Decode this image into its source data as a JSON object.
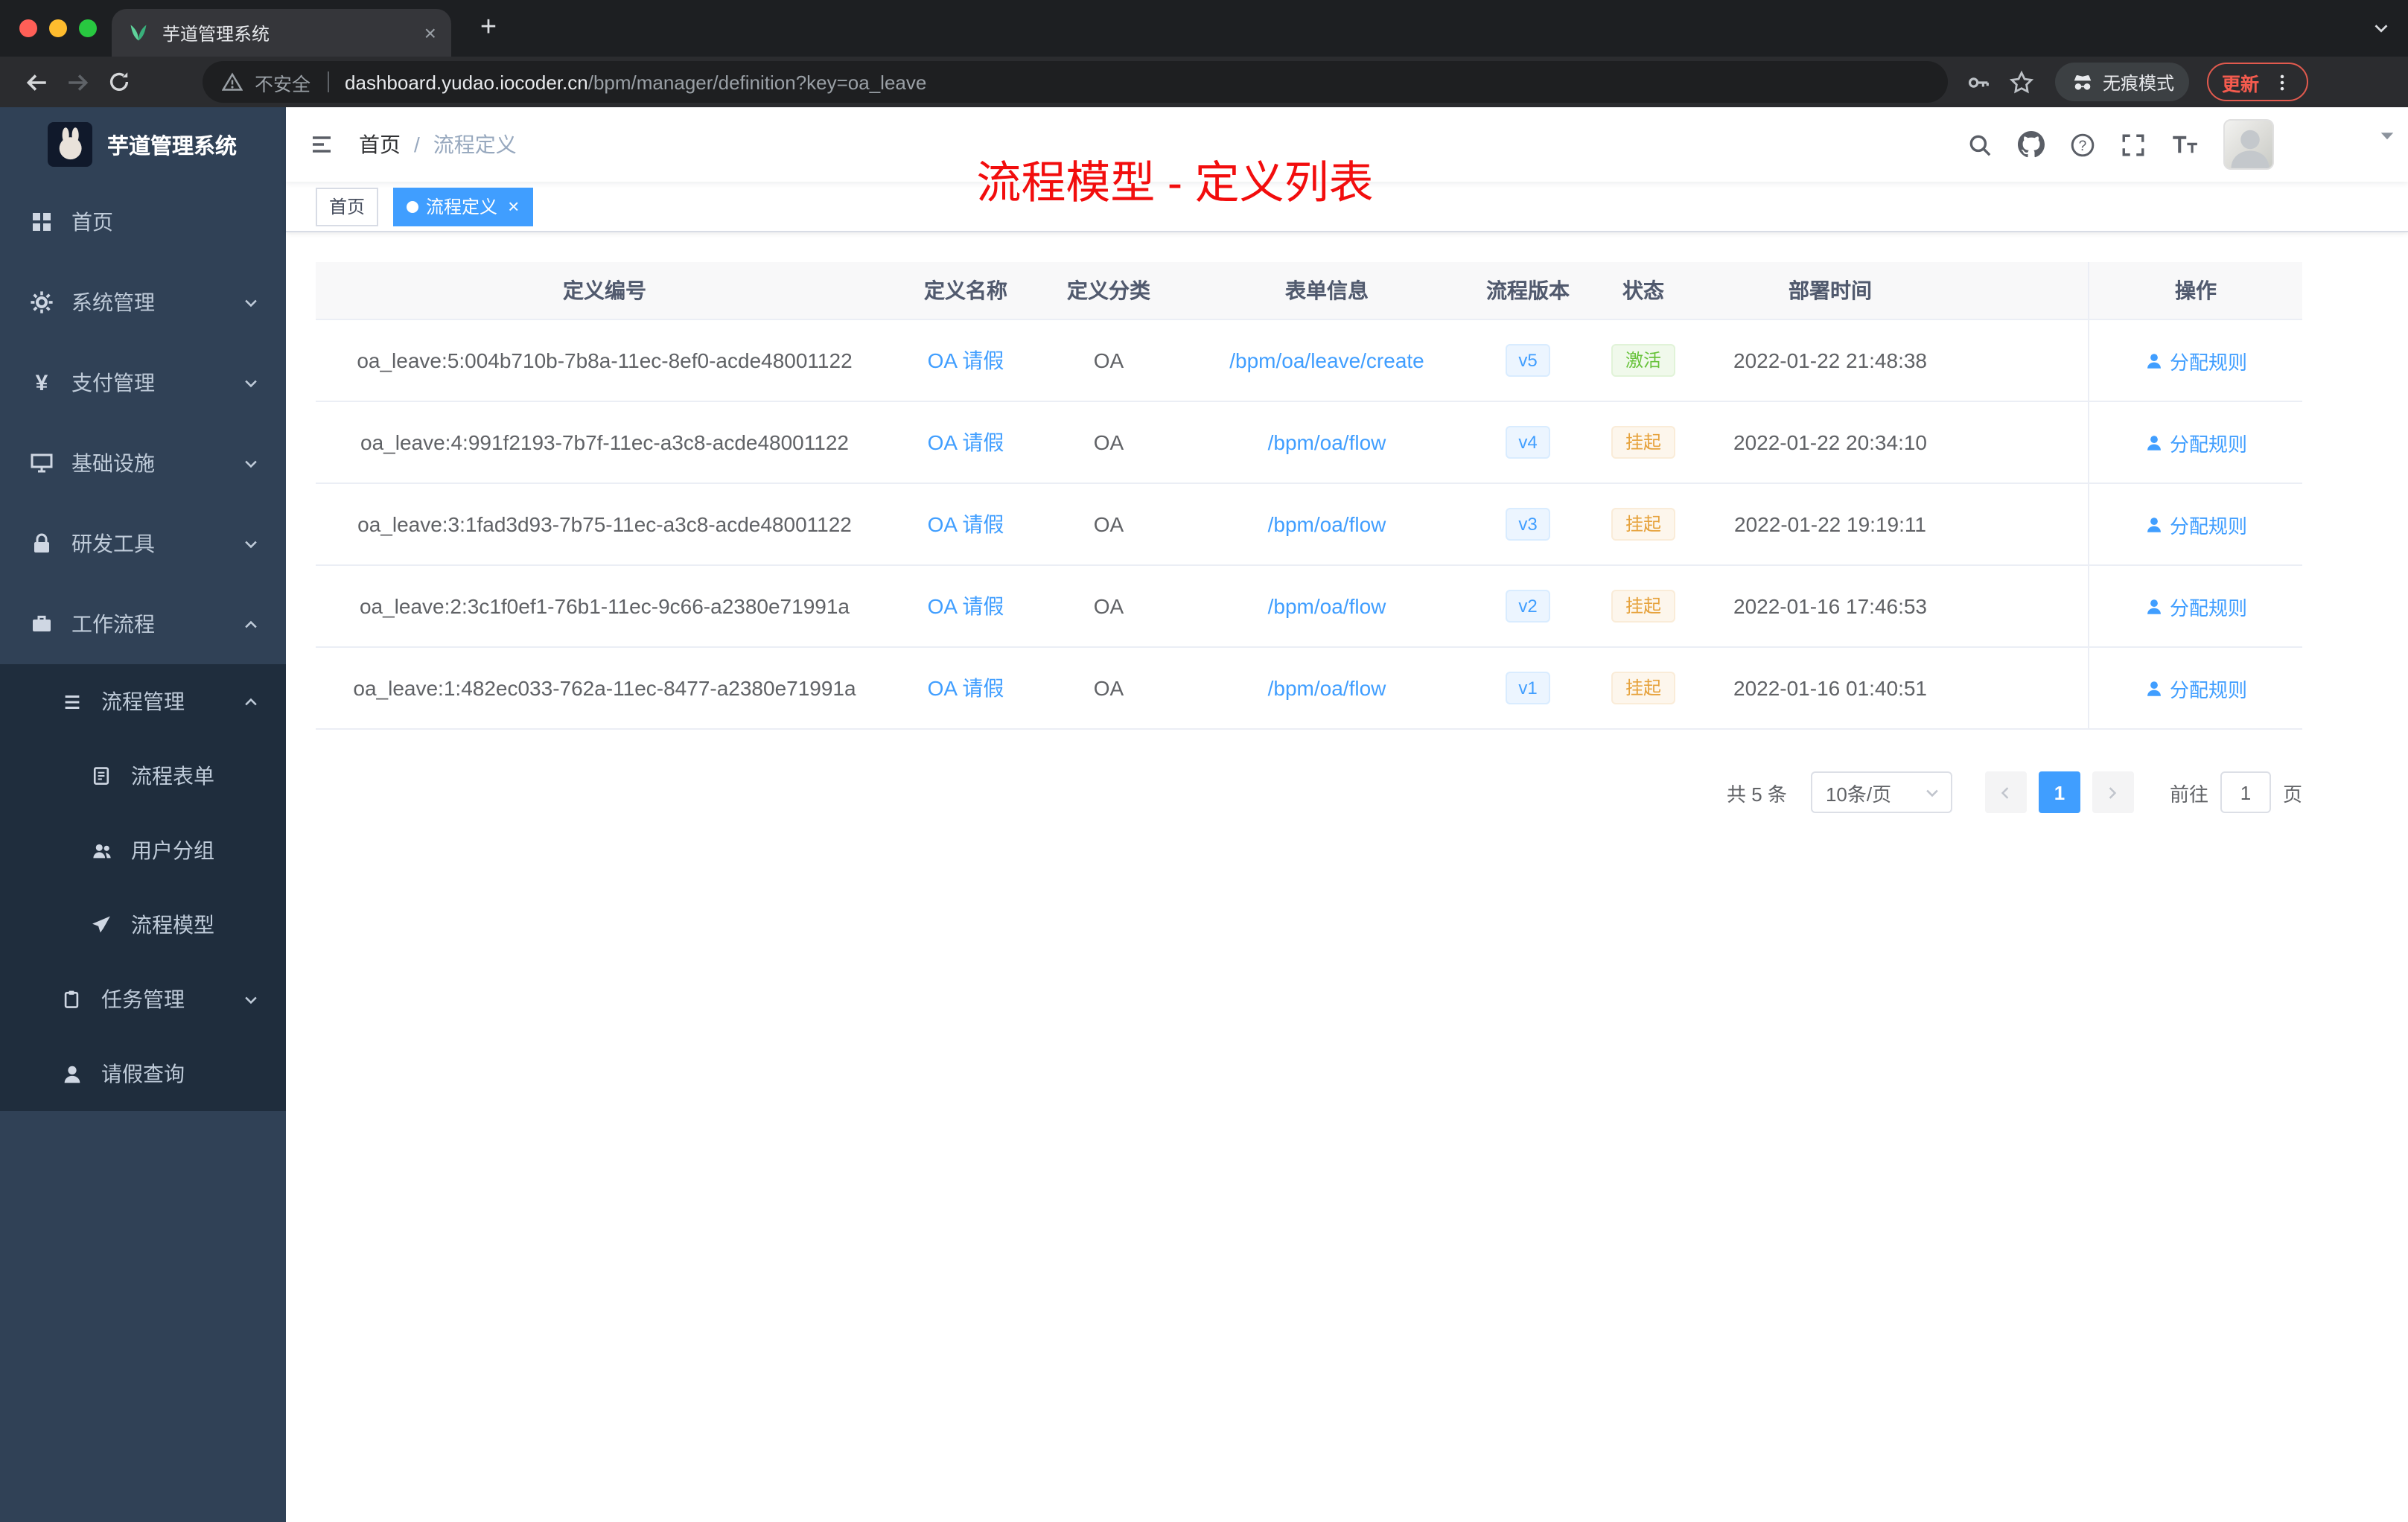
{
  "colors": {
    "accent_blue": "#409eff",
    "status_active_green": "#67c23a",
    "status_suspended_orange": "#e6a23c",
    "annotation_red": "#f20d0d",
    "sidebar_bg": "#304156",
    "sidebar_submenu_bg": "#1f2d3d",
    "update_chip_red": "#f55b4e"
  },
  "icons": {
    "favicon": "leaf shape",
    "tab_close": "×",
    "new_tab": "+",
    "back": "←",
    "forward": "→",
    "reload": "↻",
    "warning": "△",
    "key": "⚷",
    "star": "☆",
    "incognito": "spy hat",
    "menu_dots": "⋮",
    "chevron_down": "⌄",
    "chevron_up": "⌃",
    "search": "magnifier",
    "github": "octocat",
    "help": "?",
    "fullscreen": "⛶",
    "font_size": "Tt",
    "user": "person silhouette"
  },
  "browser": {
    "tab_title": "芋道管理系统",
    "tab_close": "×",
    "new_tab": "+",
    "security_label": "不安全",
    "url_host": "dashboard.yudao.iocoder.cn",
    "url_path": "/bpm/manager/definition?key=oa_leave",
    "incognito_label": "无痕模式",
    "update_label": "更新"
  },
  "sidebar": {
    "logo_title": "芋道管理系统",
    "items": [
      {
        "label": "首页"
      },
      {
        "label": "系统管理",
        "expandable": true
      },
      {
        "label": "支付管理",
        "expandable": true
      },
      {
        "label": "基础设施",
        "expandable": true
      },
      {
        "label": "研发工具",
        "expandable": true
      },
      {
        "label": "工作流程",
        "expandable": true,
        "expanded": true,
        "children": [
          {
            "label": "流程管理",
            "expanded": true,
            "children": [
              {
                "label": "流程表单"
              },
              {
                "label": "用户分组"
              },
              {
                "label": "流程模型"
              }
            ]
          },
          {
            "label": "任务管理",
            "expandable": true
          },
          {
            "label": "请假查询"
          }
        ]
      }
    ]
  },
  "header": {
    "breadcrumb": {
      "home": "首页",
      "sep": "/",
      "current": "流程定义"
    },
    "annotation": "流程模型 - 定义列表"
  },
  "tags_view": {
    "tags": [
      {
        "label": "首页",
        "active": false
      },
      {
        "label": "流程定义",
        "active": true,
        "close": "×"
      }
    ]
  },
  "table": {
    "columns": [
      "定义编号",
      "定义名称",
      "定义分类",
      "表单信息",
      "流程版本",
      "状态",
      "部署时间",
      "操作"
    ],
    "rows": [
      {
        "id": "oa_leave:5:004b710b-7b8a-11ec-8ef0-acde48001122",
        "name": "OA 请假",
        "category": "OA",
        "form": "/bpm/oa/leave/create",
        "version": "v5",
        "status": "激活",
        "status_type": "active",
        "deploy_time": "2022-01-22 21:48:38",
        "action": "分配规则"
      },
      {
        "id": "oa_leave:4:991f2193-7b7f-11ec-a3c8-acde48001122",
        "name": "OA 请假",
        "category": "OA",
        "form": "/bpm/oa/flow",
        "version": "v4",
        "status": "挂起",
        "status_type": "suspended",
        "deploy_time": "2022-01-22 20:34:10",
        "action": "分配规则"
      },
      {
        "id": "oa_leave:3:1fad3d93-7b75-11ec-a3c8-acde48001122",
        "name": "OA 请假",
        "category": "OA",
        "form": "/bpm/oa/flow",
        "version": "v3",
        "status": "挂起",
        "status_type": "suspended",
        "deploy_time": "2022-01-22 19:19:11",
        "action": "分配规则"
      },
      {
        "id": "oa_leave:2:3c1f0ef1-76b1-11ec-9c66-a2380e71991a",
        "name": "OA 请假",
        "category": "OA",
        "form": "/bpm/oa/flow",
        "version": "v2",
        "status": "挂起",
        "status_type": "suspended",
        "deploy_time": "2022-01-16 17:46:53",
        "action": "分配规则"
      },
      {
        "id": "oa_leave:1:482ec033-762a-11ec-8477-a2380e71991a",
        "name": "OA 请假",
        "category": "OA",
        "form": "/bpm/oa/flow",
        "version": "v1",
        "status": "挂起",
        "status_type": "suspended",
        "deploy_time": "2022-01-16 01:40:51",
        "action": "分配规则"
      }
    ]
  },
  "pagination": {
    "total_label": "共 5 条",
    "page_size_label": "10条/页",
    "current_page": "1",
    "jump_prefix": "前往",
    "jump_value": "1",
    "jump_suffix": "页"
  }
}
